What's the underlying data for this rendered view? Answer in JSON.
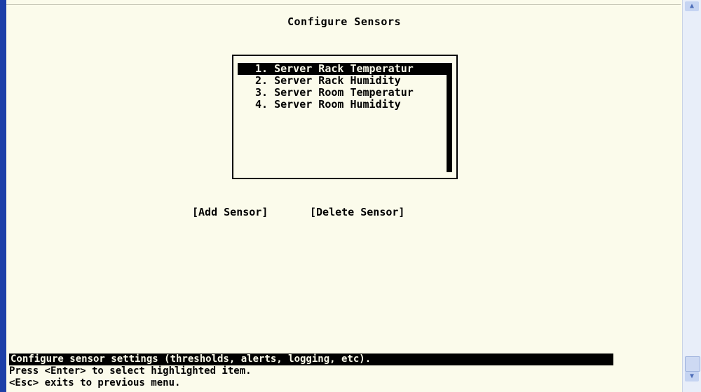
{
  "screen": {
    "title": "Configure Sensors"
  },
  "sensor_list": {
    "items": [
      {
        "label": "1. Server Rack Temperatur",
        "selected": true
      },
      {
        "label": "2. Server Rack Humidity",
        "selected": false
      },
      {
        "label": "3. Server Room Temperatur",
        "selected": false
      },
      {
        "label": "4. Server Room Humidity",
        "selected": false
      }
    ]
  },
  "buttons": {
    "add_label": "[Add Sensor]",
    "delete_label": "[Delete Sensor]"
  },
  "status": {
    "description": "Configure sensor settings (thresholds, alerts, logging, etc).",
    "hint_enter": "Press <Enter> to select highlighted item.",
    "hint_esc": "<Esc> exits to previous menu."
  },
  "colors": {
    "background": "#fbfbeb",
    "foreground": "#000000",
    "window_border": "#1d3fa8"
  }
}
